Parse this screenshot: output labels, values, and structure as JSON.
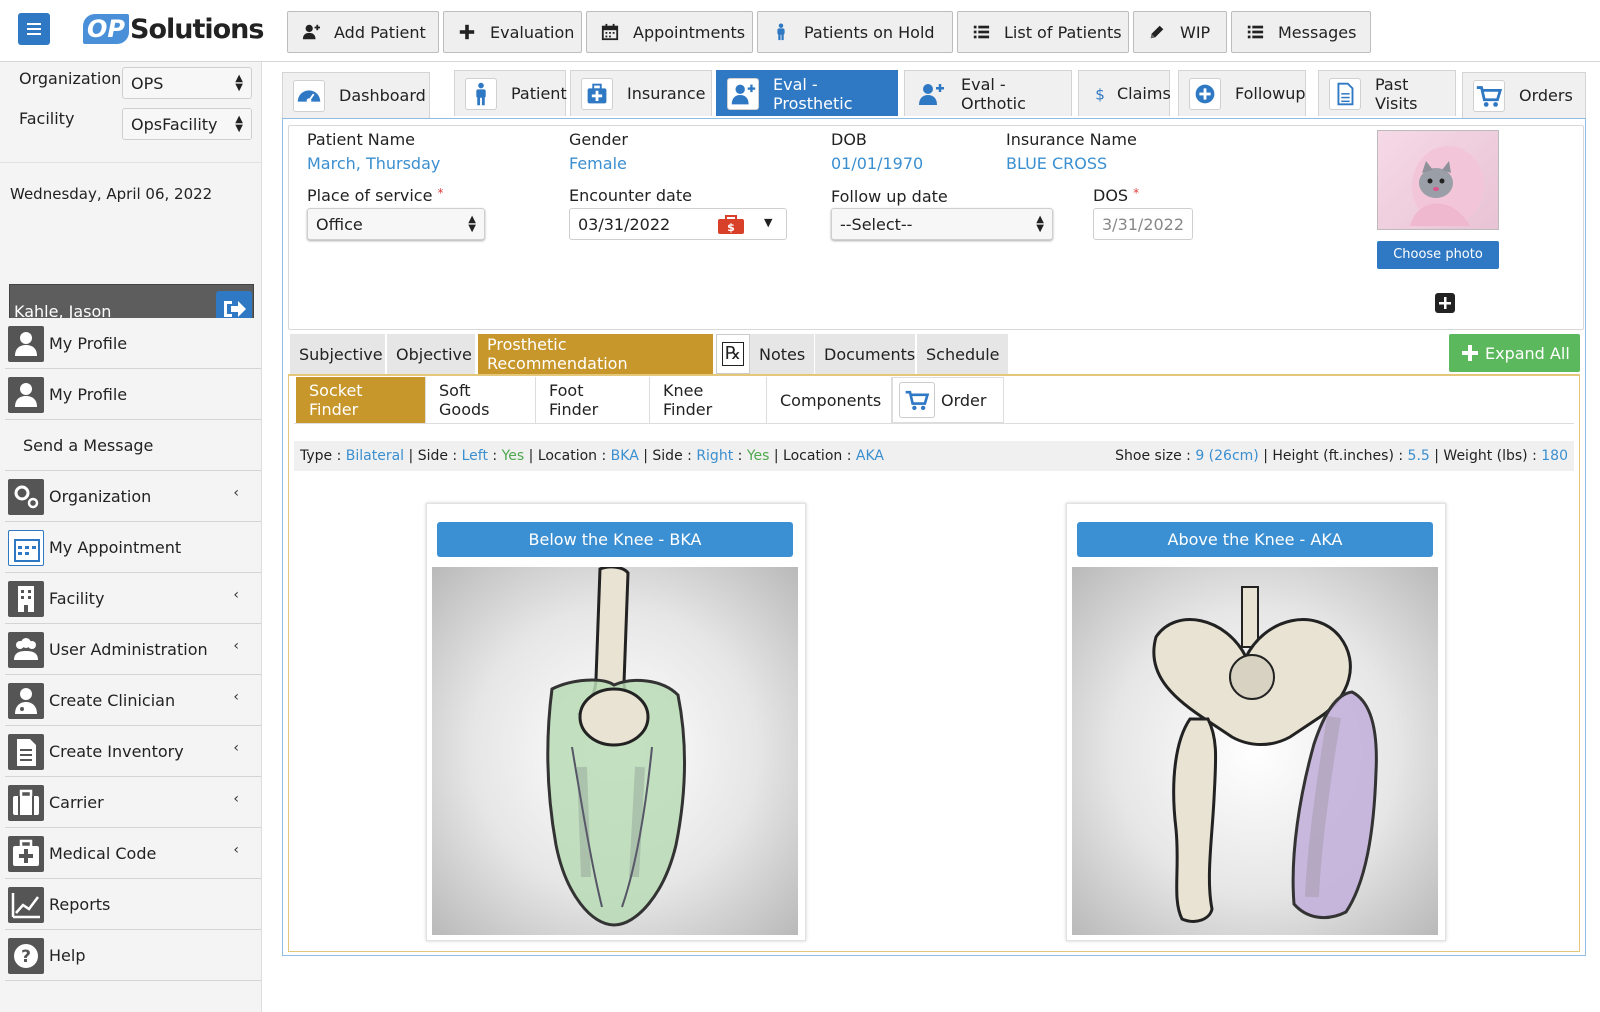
{
  "app": {
    "logo_op": "OP",
    "logo_text": "Solutions"
  },
  "toolbar": [
    {
      "label": "Add Patient",
      "icon": "add-user-icon"
    },
    {
      "label": "Evaluation",
      "icon": "plus-icon"
    },
    {
      "label": "Appointments",
      "icon": "calendar-icon"
    },
    {
      "label": "Patients on Hold",
      "icon": "person-icon"
    },
    {
      "label": "List of Patients",
      "icon": "list-icon"
    },
    {
      "label": "WIP",
      "icon": "pencil-icon"
    },
    {
      "label": "Messages",
      "icon": "list-icon"
    }
  ],
  "sidebar": {
    "org_label": "Organization",
    "org_value": "OPS",
    "facility_label": "Facility",
    "facility_value": "OpsFacility",
    "date": "Wednesday, April 06, 2022",
    "user": "Kahle, Jason",
    "items": [
      {
        "label": "My Profile",
        "icon": "user-icon",
        "chevron": false
      },
      {
        "label": "My Profile",
        "icon": "user-icon",
        "chevron": false
      },
      {
        "label": "Send a Message",
        "icon": "",
        "chevron": false
      },
      {
        "label": "Organization",
        "icon": "gears-icon",
        "chevron": true
      },
      {
        "label": "My Appointment",
        "icon": "calendar-icon",
        "chevron": false
      },
      {
        "label": "Facility",
        "icon": "building-icon",
        "chevron": true
      },
      {
        "label": "User Administration",
        "icon": "users-icon",
        "chevron": true
      },
      {
        "label": "Create Clinician",
        "icon": "doctor-icon",
        "chevron": true
      },
      {
        "label": "Create Inventory",
        "icon": "document-icon",
        "chevron": true
      },
      {
        "label": "Carrier",
        "icon": "briefcase-icon",
        "chevron": true
      },
      {
        "label": "Medical Code",
        "icon": "medkit-icon",
        "chevron": true
      },
      {
        "label": "Reports",
        "icon": "chart-icon",
        "chevron": false
      },
      {
        "label": "Help",
        "icon": "question-icon",
        "chevron": false
      }
    ],
    "chevron_glyph": "‹"
  },
  "tabs": [
    {
      "label": "Dashboard",
      "icon": "dashboard-icon"
    },
    {
      "label": "Patient",
      "icon": "person-icon"
    },
    {
      "label": "Insurance",
      "icon": "medkit-icon"
    },
    {
      "label": "Eval - Prosthetic",
      "icon": "add-user-icon",
      "active": true
    },
    {
      "label": "Eval - Orthotic",
      "icon": "add-user-icon"
    },
    {
      "label": "Claims",
      "icon": "dollar-icon"
    },
    {
      "label": "Followup",
      "icon": "plus-circle-icon"
    },
    {
      "label": "Past Visits",
      "icon": "document-icon"
    },
    {
      "label": "Orders",
      "icon": "cart-icon"
    }
  ],
  "patient": {
    "name_label": "Patient Name",
    "name": "March, Thursday",
    "gender_label": "Gender",
    "gender": "Female",
    "dob_label": "DOB",
    "dob": "01/01/1970",
    "ins_label": "Insurance Name",
    "ins": "BLUE CROSS",
    "pos_label": "Place of service",
    "pos": "Office",
    "enc_label": "Encounter date",
    "enc": "03/31/2022",
    "fu_label": "Follow up date",
    "fu": "--Select--",
    "dos_label": "DOS",
    "dos": "3/31/2022",
    "photo_btn": "Choose photo",
    "required": "*"
  },
  "subtabs": [
    {
      "label": "Subjective"
    },
    {
      "label": "Objective"
    },
    {
      "label": "Prosthetic Recommendation",
      "active": true
    },
    {
      "label": "℞",
      "icon": "rx-icon"
    },
    {
      "label": "Notes"
    },
    {
      "label": "Documents"
    },
    {
      "label": "Schedule"
    }
  ],
  "expand_all": "Expand All",
  "finder_tabs": [
    {
      "label": "Socket Finder",
      "active": true
    },
    {
      "label": "Soft Goods"
    },
    {
      "label": "Foot Finder"
    },
    {
      "label": "Knee Finder"
    },
    {
      "label": "Components"
    },
    {
      "label": "Order",
      "icon": "cart-icon"
    }
  ],
  "infobar": {
    "type_label": "Type :",
    "type": "Bilateral",
    "side_label": "Side :",
    "side1": "Left",
    "yes1": "Yes",
    "loc_label": "Location :",
    "loc1": "BKA",
    "side2": "Right",
    "yes2": "Yes",
    "loc2": "AKA",
    "shoe_label": "Shoe size :",
    "shoe": "9 (26cm)",
    "height_label": "Height (ft.inches) :",
    "height": "5.5",
    "weight_label": "Weight (lbs) :",
    "weight": "180",
    "sep": "|",
    "colon": ":"
  },
  "cards": [
    {
      "title": "Below the Knee - BKA",
      "image": "bka-knee-socket-illustration"
    },
    {
      "title": "Above the Knee - AKA",
      "image": "aka-pelvis-socket-illustration"
    }
  ],
  "colors": {
    "primary": "#2f78c3",
    "gold": "#c8972b",
    "green": "#5cb85c",
    "link": "#3a8fd0"
  }
}
